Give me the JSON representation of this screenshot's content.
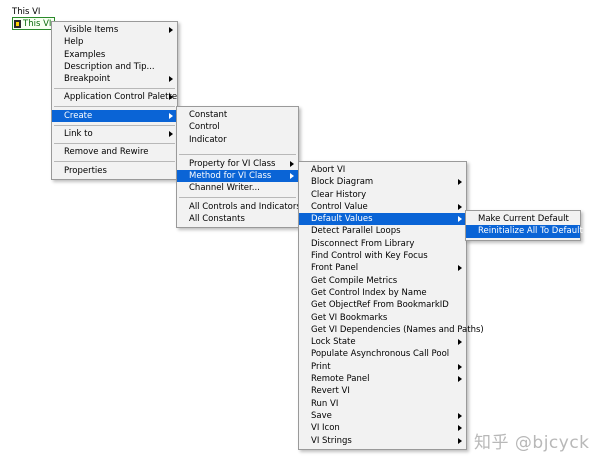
{
  "vi": {
    "title": "This VI",
    "node_label": "This VI"
  },
  "menu1": {
    "groups": [
      [
        "Visible Items",
        "Help",
        "Examples",
        "Description and Tip...",
        "Breakpoint"
      ],
      [
        "Application Control Palette"
      ],
      [
        "Create"
      ],
      [
        "Link to"
      ],
      [
        "Remove and Rewire"
      ],
      [
        "Properties"
      ]
    ]
  },
  "menu2": {
    "items_a": [
      "Constant",
      "Control",
      "Indicator"
    ],
    "items_b": [
      "Property for VI Class",
      "Method for VI Class",
      "Channel Writer..."
    ],
    "items_c": [
      "All Controls and Indicators",
      "All Constants"
    ]
  },
  "menu3": {
    "items": [
      "Abort VI",
      "Block Diagram",
      "Clear History",
      "Control Value",
      "Default Values",
      "Detect Parallel Loops",
      "Disconnect From Library",
      "Find Control with Key Focus",
      "Front Panel",
      "Get Compile Metrics",
      "Get Control Index by Name",
      "Get ObjectRef From BookmarkID",
      "Get VI Bookmarks",
      "Get VI Dependencies (Names and Paths)",
      "Lock State",
      "Populate Asynchronous Call Pool",
      "Print",
      "Remote Panel",
      "Revert VI",
      "Run VI",
      "Save",
      "VI Icon",
      "VI Strings"
    ]
  },
  "menu4": {
    "items": [
      "Make Current Default",
      "Reinitialize All To Default"
    ]
  },
  "watermark": "知乎 @bjcyck",
  "colors": {
    "highlight": "#0a64d6",
    "menu_bg": "#f2f2f2"
  }
}
